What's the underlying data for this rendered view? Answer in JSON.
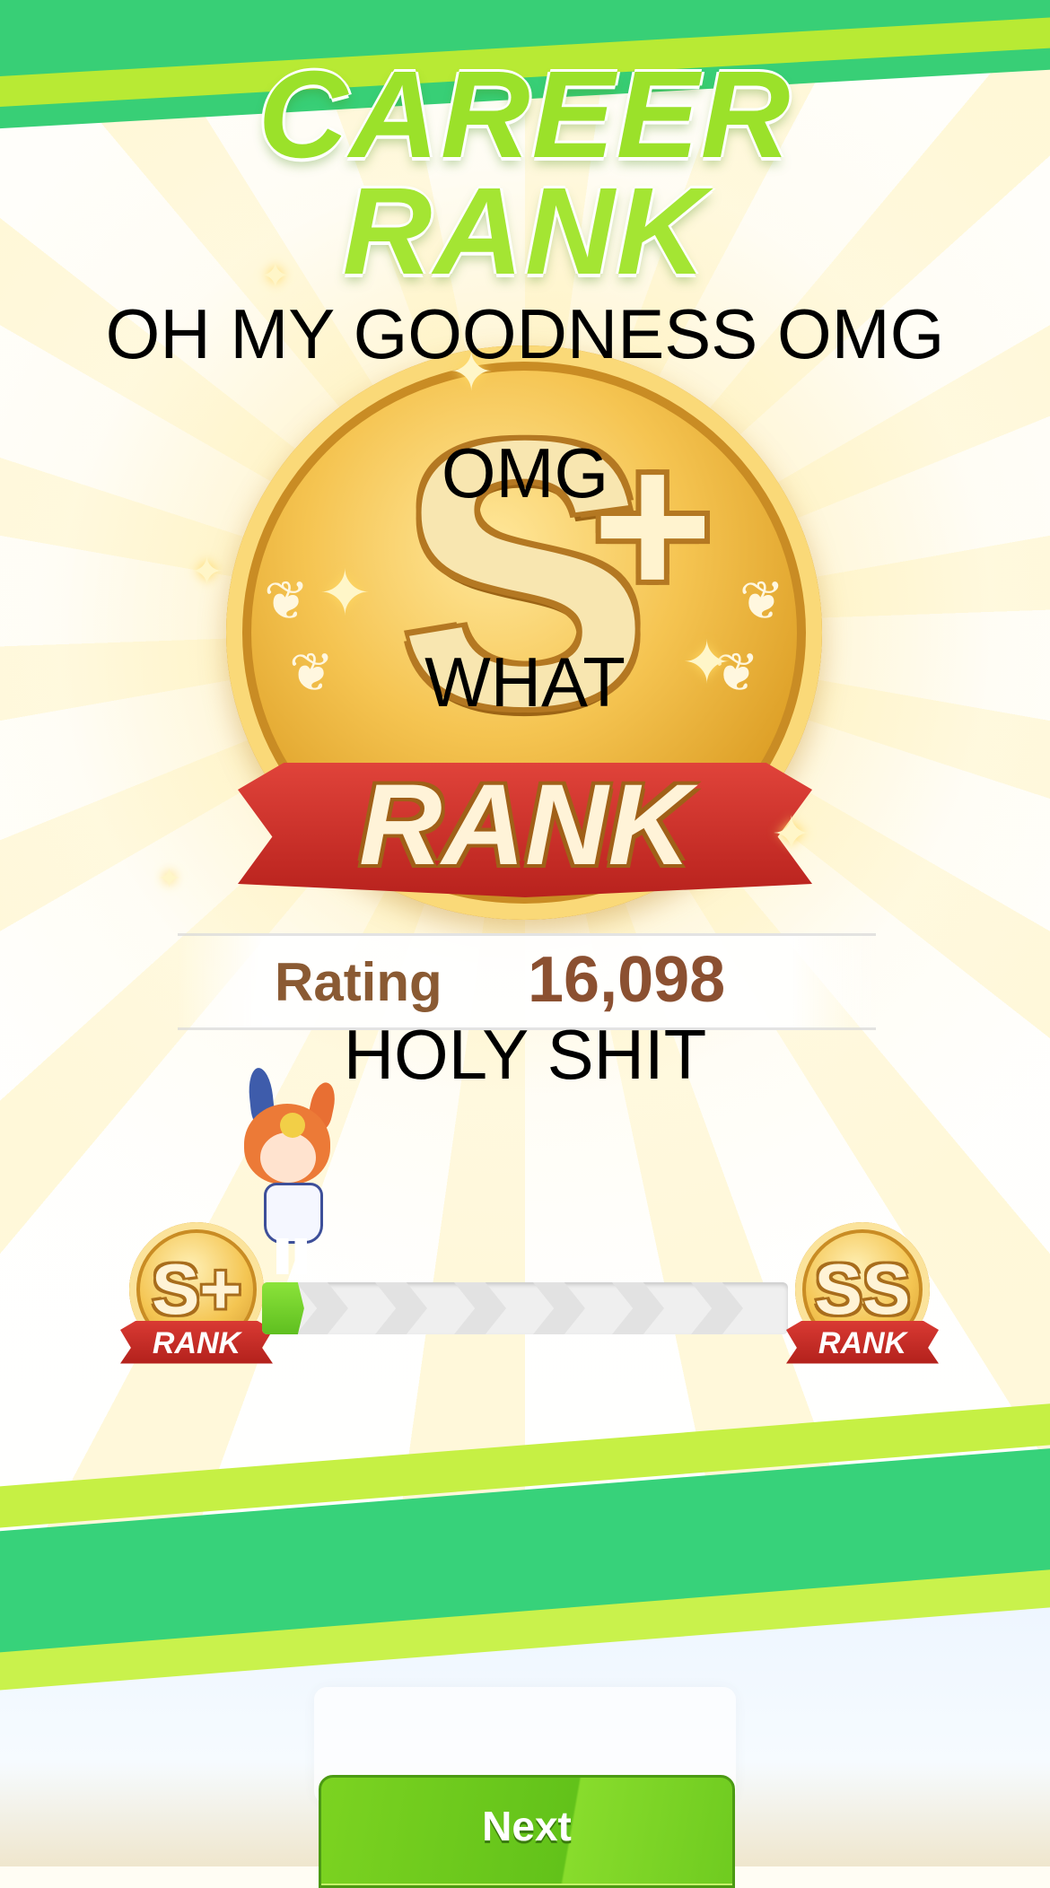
{
  "screen": {
    "title_line_1": "CAREER",
    "title_line_2": "RANK"
  },
  "rank_badge": {
    "letter": "S",
    "modifier": "+",
    "ribbon_label": "RANK"
  },
  "rating": {
    "label": "Rating",
    "value": "16,098"
  },
  "captions": {
    "line_1": "OH MY GOODNESS OMG",
    "line_2": "OMG",
    "line_3": "WHAT",
    "line_4": "HOLY SHIT"
  },
  "progress": {
    "current_rank": {
      "letter": "S+",
      "label": "RANK"
    },
    "next_rank": {
      "letter": "SS",
      "label": "RANK"
    },
    "fill_fraction": 0.08
  },
  "footer": {
    "next_label": "Next"
  },
  "colors": {
    "stripe_green": "#38cf76",
    "stripe_lime": "#b8ea34",
    "title_green": "#9be12a",
    "gold": "#f5c451",
    "ribbon_red": "#c92b24",
    "rating_brown": "#8b5031",
    "button_green": "#6fcb20"
  }
}
